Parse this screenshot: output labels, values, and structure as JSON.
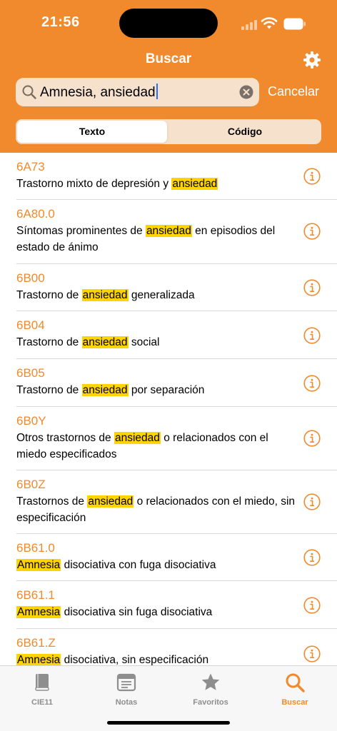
{
  "status_bar": {
    "time": "21:56"
  },
  "nav": {
    "title": "Buscar"
  },
  "search": {
    "query": "Amnesia, ansiedad",
    "cancel_label": "Cancelar"
  },
  "segments": {
    "text": "Texto",
    "code": "Código",
    "selected": "Texto"
  },
  "results": [
    {
      "code": "6A73",
      "parts": [
        "Trastorno mixto de depresión y ",
        "ansiedad",
        ""
      ]
    },
    {
      "code": "6A80.0",
      "parts": [
        "Síntomas prominentes de ",
        "ansiedad",
        " en episodios del estado de ánimo"
      ]
    },
    {
      "code": "6B00",
      "parts": [
        "Trastorno de ",
        "ansiedad",
        " generalizada"
      ]
    },
    {
      "code": "6B04",
      "parts": [
        "Trastorno de ",
        "ansiedad",
        " social"
      ]
    },
    {
      "code": "6B05",
      "parts": [
        "Trastorno de ",
        "ansiedad",
        " por separación"
      ]
    },
    {
      "code": "6B0Y",
      "parts": [
        "Otros trastornos de ",
        "ansiedad",
        " o relacionados con el miedo especificados"
      ]
    },
    {
      "code": "6B0Z",
      "parts": [
        "Trastornos de ",
        "ansiedad",
        " o relacionados con el miedo, sin especificación"
      ]
    },
    {
      "code": "6B61.0",
      "parts": [
        "",
        "Amnesia",
        " disociativa con fuga disociativa"
      ]
    },
    {
      "code": "6B61.1",
      "parts": [
        "",
        "Amnesia",
        " disociativa sin fuga disociativa"
      ]
    },
    {
      "code": "6B61.Z",
      "parts": [
        "",
        "Amnesia",
        " disociativa, sin especificación"
      ]
    }
  ],
  "tabs": [
    {
      "label": "CIE11",
      "icon": "book-icon"
    },
    {
      "label": "Notas",
      "icon": "notes-icon"
    },
    {
      "label": "Favoritos",
      "icon": "star-icon"
    },
    {
      "label": "Buscar",
      "icon": "search-icon"
    }
  ],
  "colors": {
    "accent": "#f18a2c",
    "highlight": "#ffd400",
    "tab_inactive": "#8e8e8e"
  }
}
